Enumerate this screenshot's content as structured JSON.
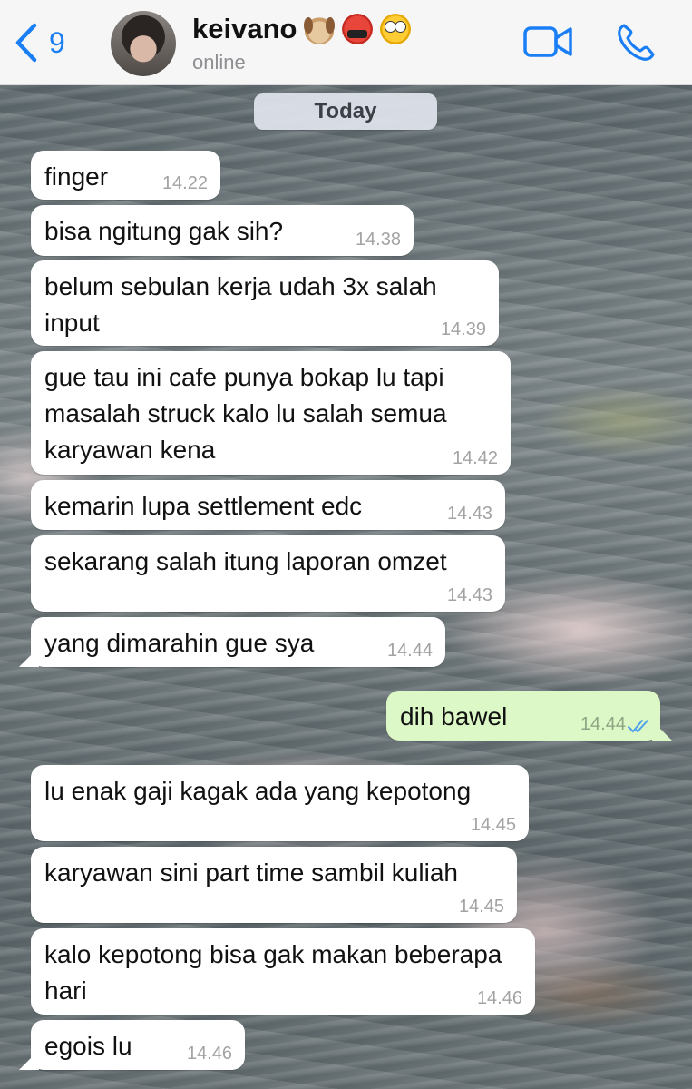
{
  "header": {
    "back_count": "9",
    "contact_name": "keivano",
    "status": "online",
    "emojis": [
      "dog-face",
      "face-with-symbols-on-mouth",
      "face-with-rolling-eyes"
    ]
  },
  "date_chip": "Today",
  "colors": {
    "accent": "#1a7ff5",
    "incoming_bubble": "#ffffff",
    "outgoing_bubble": "#dcf8c6",
    "read_ticks": "#4fa3e8"
  },
  "messages": [
    {
      "text": "finger",
      "time": "14.22",
      "direction": "in"
    },
    {
      "text": "bisa ngitung gak sih?",
      "time": "14.38",
      "direction": "in"
    },
    {
      "text": "belum sebulan kerja udah 3x salah input",
      "time": "14.39",
      "direction": "in"
    },
    {
      "text": "gue tau ini cafe punya bokap lu tapi masalah struck kalo lu salah semua karyawan kena",
      "time": "14.42",
      "direction": "in"
    },
    {
      "text": "kemarin lupa settlement edc",
      "time": "14.43",
      "direction": "in"
    },
    {
      "text": "sekarang salah itung laporan omzet",
      "time": "14.43",
      "direction": "in"
    },
    {
      "text": "yang dimarahin gue sya",
      "time": "14.44",
      "direction": "in"
    },
    {
      "text": "dih bawel",
      "time": "14.44",
      "direction": "out",
      "status": "read"
    },
    {
      "text": "lu enak gaji kagak ada yang kepotong",
      "time": "14.45",
      "direction": "in"
    },
    {
      "text": "karyawan sini part time sambil kuliah",
      "time": "14.45",
      "direction": "in"
    },
    {
      "text": "kalo kepotong bisa gak makan beberapa hari",
      "time": "14.46",
      "direction": "in"
    },
    {
      "text": "egois lu",
      "time": "14.46",
      "direction": "in"
    }
  ]
}
